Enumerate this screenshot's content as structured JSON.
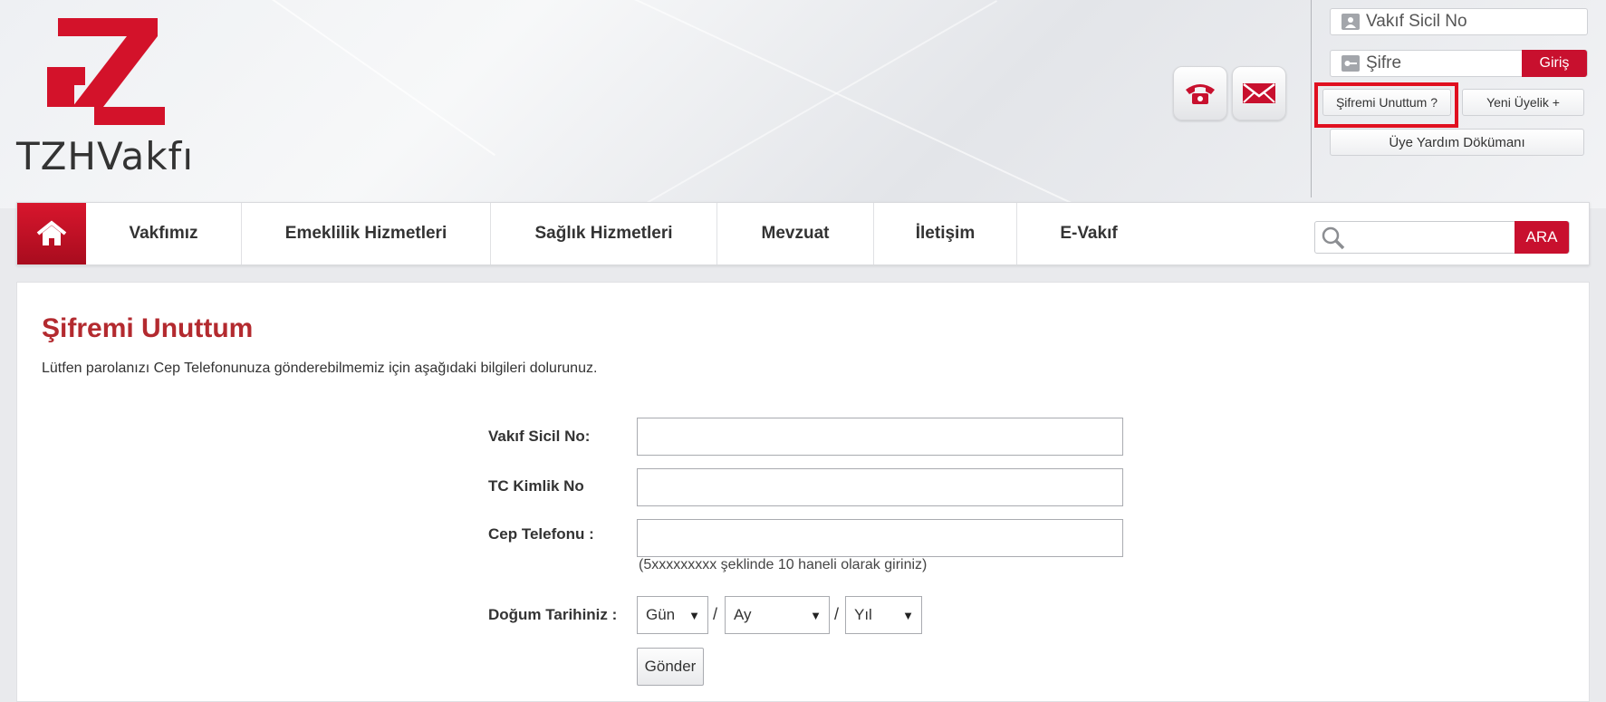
{
  "logo": {
    "text": "TZHVakfı",
    "brand_color": "#c8102e"
  },
  "header": {
    "contact_icons": [
      "phone-icon",
      "mail-icon"
    ]
  },
  "login": {
    "sicil_placeholder": "Vakıf Sicil No",
    "sifre_placeholder": "Şifre",
    "giris_label": "Giriş",
    "forgot_label": "Şifremi Unuttum ?",
    "register_label": "Yeni Üyelik +",
    "help_doc_label": "Üye Yardım Dökümanı"
  },
  "nav": {
    "items": [
      "Vakfımız",
      "Emeklilik Hizmetleri",
      "Sağlık Hizmetleri",
      "Mevzuat",
      "İletişim",
      "E-Vakıf"
    ],
    "search_button": "ARA"
  },
  "page": {
    "title": "Şifremi Unuttum",
    "description": "Lütfen parolanızı Cep Telefonunuza gönderebilmemiz için aşağıdaki bilgileri dolurunuz."
  },
  "form": {
    "sicil_label": "Vakıf Sicil No:",
    "tc_label": "TC Kimlik No",
    "phone_label": "Cep Telefonu :",
    "phone_hint": "(5xxxxxxxxx şeklinde 10 haneli olarak giriniz)",
    "birth_label": "Doğum Tarihiniz :",
    "day_value": "Gün",
    "month_value": "Ay",
    "year_value": "Yıl",
    "separator": "/",
    "submit_label": "Gönder"
  },
  "colors": {
    "accent": "#c8102e",
    "title": "#b32a2f"
  }
}
